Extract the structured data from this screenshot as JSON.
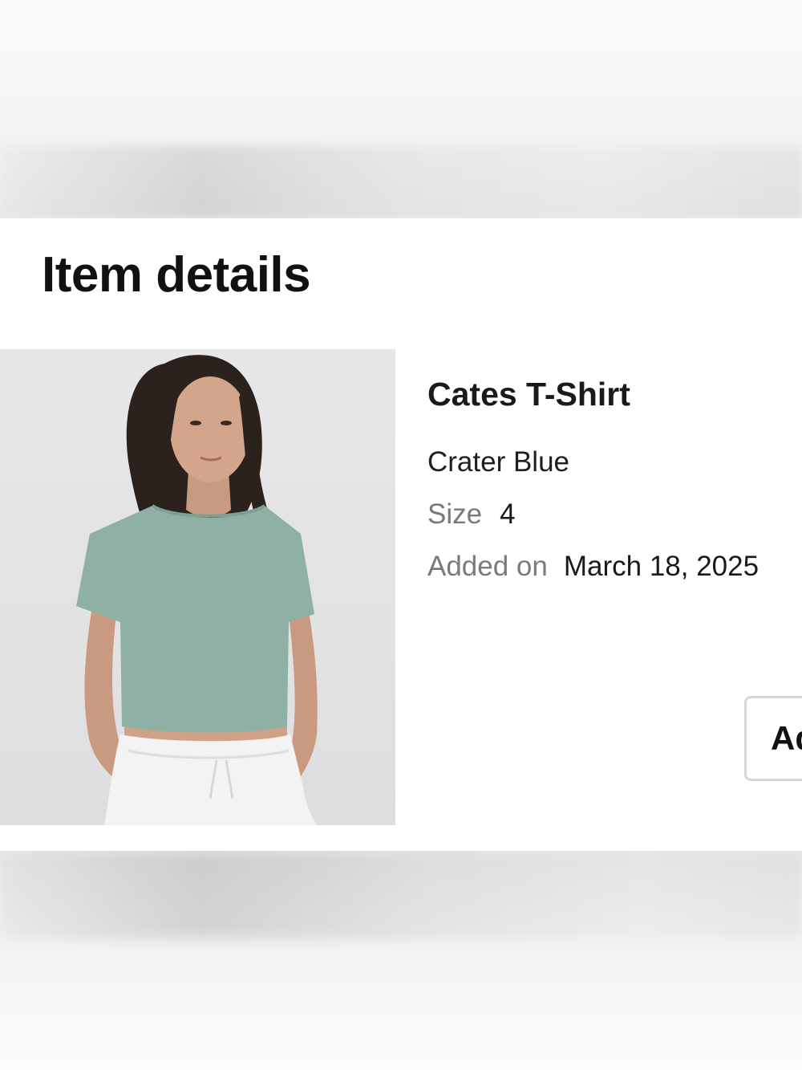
{
  "sheet": {
    "title": "Item details"
  },
  "product": {
    "name": "Cates T-Shirt",
    "color": "Crater Blue",
    "size_label": "Size",
    "size_value": "4",
    "added_label": "Added on",
    "added_value": "March 18, 2025",
    "image_icon": "product-photo"
  },
  "actions": {
    "primary_label": "Ad"
  },
  "colors": {
    "shirt": "#8fb0a4",
    "sheet_background": "#ffffff",
    "muted_text": "#7a7a7a"
  }
}
